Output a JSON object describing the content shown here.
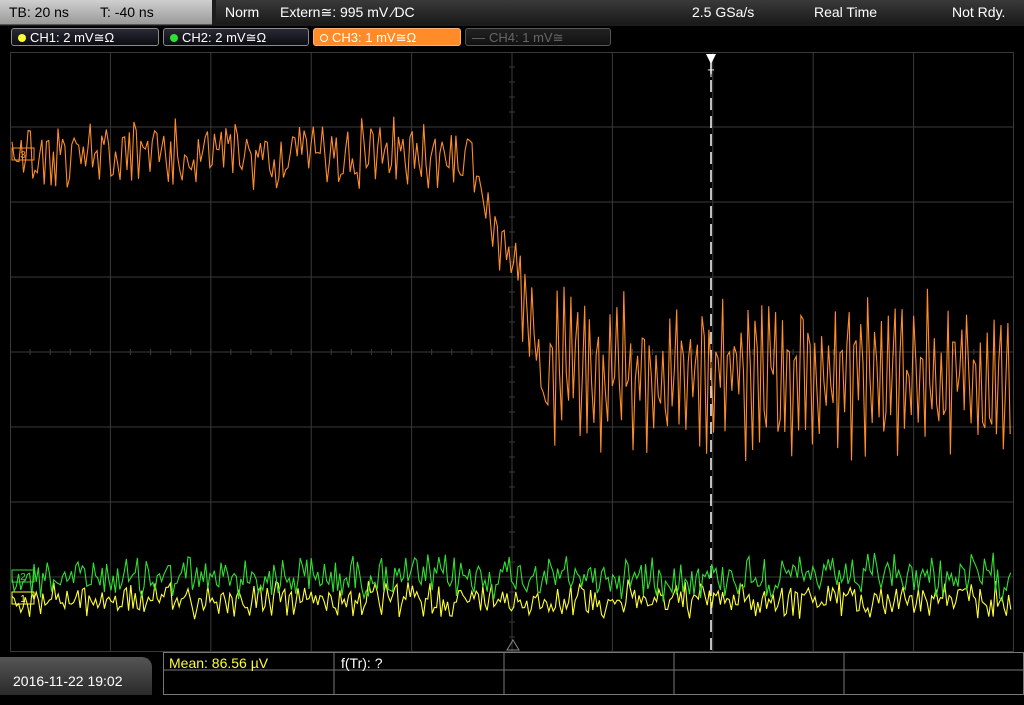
{
  "timebase": {
    "tb": "TB: 20 ns",
    "t": "T: -40 ns"
  },
  "status": {
    "mode": "Norm",
    "trigger": "Extern≅: 995 mV ∕DC",
    "sample_rate": "2.5 GSa/s",
    "acq": "Real Time",
    "ready": "Not Rdy."
  },
  "channels": [
    {
      "label": "CH1: 2 mV≅Ω",
      "color": "#ffff30",
      "state": "on"
    },
    {
      "label": "CH2: 2 mV≅Ω",
      "color": "#30e030",
      "state": "on"
    },
    {
      "label": "CH3: 1 mV≅Ω",
      "color": "#ff8c28",
      "state": "active"
    },
    {
      "label": "CH4: 1 mV≅",
      "color": "#555555",
      "state": "off"
    }
  ],
  "trigger_marker": "T",
  "ch_markers": {
    "ch3": "3",
    "ch2": "2",
    "ch1": "1"
  },
  "datetime": "2016-11-22 19:02",
  "measurements": {
    "mean": "Mean: 86.56 µV",
    "ftr": "f(Tr): ?"
  },
  "colors": {
    "grid": "#3a3a3a",
    "ch1": "#ffff30",
    "ch2": "#30e030",
    "ch3": "#ff8c28"
  }
}
